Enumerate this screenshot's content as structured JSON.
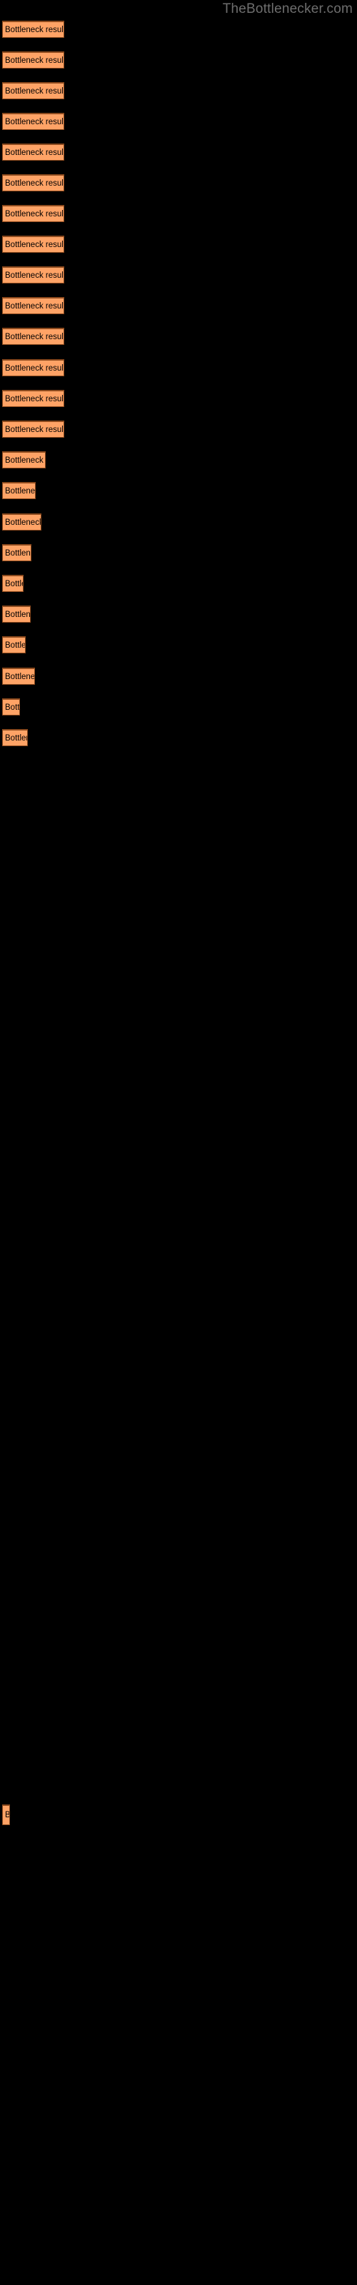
{
  "site": {
    "title": "TheBottlenecker.com",
    "title_color": "#6e6e6e"
  },
  "theme": {
    "background": "#000000",
    "bar_fill": "#ffa366",
    "bar_border": "#8c4a1e",
    "bar_label_color": "#000000"
  },
  "chart_data": {
    "type": "bar",
    "orientation": "horizontal",
    "title": "TheBottlenecker.com",
    "xlabel": "",
    "ylabel": "",
    "grid": false,
    "legend": null,
    "bar_label_text": "Bottleneck result",
    "categories": [
      "Bottleneck result",
      "Bottleneck result",
      "Bottleneck result",
      "Bottleneck result",
      "Bottleneck result",
      "Bottleneck result",
      "Bottleneck result",
      "Bottleneck result",
      "Bottleneck result",
      "Bottleneck result",
      "Bottleneck result",
      "Bottleneck result",
      "Bottleneck result",
      "Bottleneck result",
      "Bottleneck result",
      "Bottleneck result",
      "Bottleneck result",
      "Bottleneck result",
      "Bottleneck result",
      "Bottleneck result",
      "Bottleneck result",
      "Bottleneck result",
      "Bottleneck result",
      "Bottleneck result",
      "Bottleneck result"
    ],
    "values": [
      87,
      87,
      87,
      87,
      87,
      87,
      87,
      87,
      87,
      87,
      87,
      87,
      87,
      87,
      61,
      47,
      55,
      41,
      30,
      40,
      33,
      46,
      25,
      36,
      11
    ],
    "xlim": [
      0,
      500
    ],
    "bars": [
      {
        "label": "Bottleneck result",
        "width": 87,
        "top": 29,
        "height": 24
      },
      {
        "label": "Bottleneck result",
        "width": 87,
        "top": 72,
        "height": 24
      },
      {
        "label": "Bottleneck result",
        "width": 87,
        "top": 115,
        "height": 24
      },
      {
        "label": "Bottleneck result",
        "width": 87,
        "top": 158,
        "height": 24
      },
      {
        "label": "Bottleneck result",
        "width": 87,
        "top": 201,
        "height": 24
      },
      {
        "label": "Bottleneck result",
        "width": 87,
        "top": 244,
        "height": 24
      },
      {
        "label": "Bottleneck result",
        "width": 87,
        "top": 287,
        "height": 24
      },
      {
        "label": "Bottleneck result",
        "width": 87,
        "top": 330,
        "height": 24
      },
      {
        "label": "Bottleneck result",
        "width": 87,
        "top": 373,
        "height": 24
      },
      {
        "label": "Bottleneck result",
        "width": 87,
        "top": 416,
        "height": 24
      },
      {
        "label": "Bottleneck result",
        "width": 87,
        "top": 459,
        "height": 24
      },
      {
        "label": "Bottleneck result",
        "width": 87,
        "top": 503,
        "height": 24
      },
      {
        "label": "Bottleneck result",
        "width": 87,
        "top": 546,
        "height": 24
      },
      {
        "label": "Bottleneck result",
        "width": 87,
        "top": 589,
        "height": 24
      },
      {
        "label": "Bottleneck result",
        "width": 61,
        "top": 632,
        "height": 24
      },
      {
        "label": "Bottleneck result",
        "width": 47,
        "top": 675,
        "height": 24
      },
      {
        "label": "Bottleneck result",
        "width": 55,
        "top": 719,
        "height": 24
      },
      {
        "label": "Bottleneck result",
        "width": 41,
        "top": 762,
        "height": 24
      },
      {
        "label": "Bottleneck result",
        "width": 30,
        "top": 805,
        "height": 24
      },
      {
        "label": "Bottleneck result",
        "width": 40,
        "top": 848,
        "height": 24
      },
      {
        "label": "Bottleneck result",
        "width": 33,
        "top": 891,
        "height": 24
      },
      {
        "label": "Bottleneck result",
        "width": 46,
        "top": 935,
        "height": 24
      },
      {
        "label": "Bottleneck result",
        "width": 25,
        "top": 978,
        "height": 24
      },
      {
        "label": "Bottleneck result",
        "width": 36,
        "top": 1021,
        "height": 24
      },
      {
        "label": "Bottleneck result",
        "width": 11,
        "top": 2527,
        "height": 29
      }
    ]
  }
}
